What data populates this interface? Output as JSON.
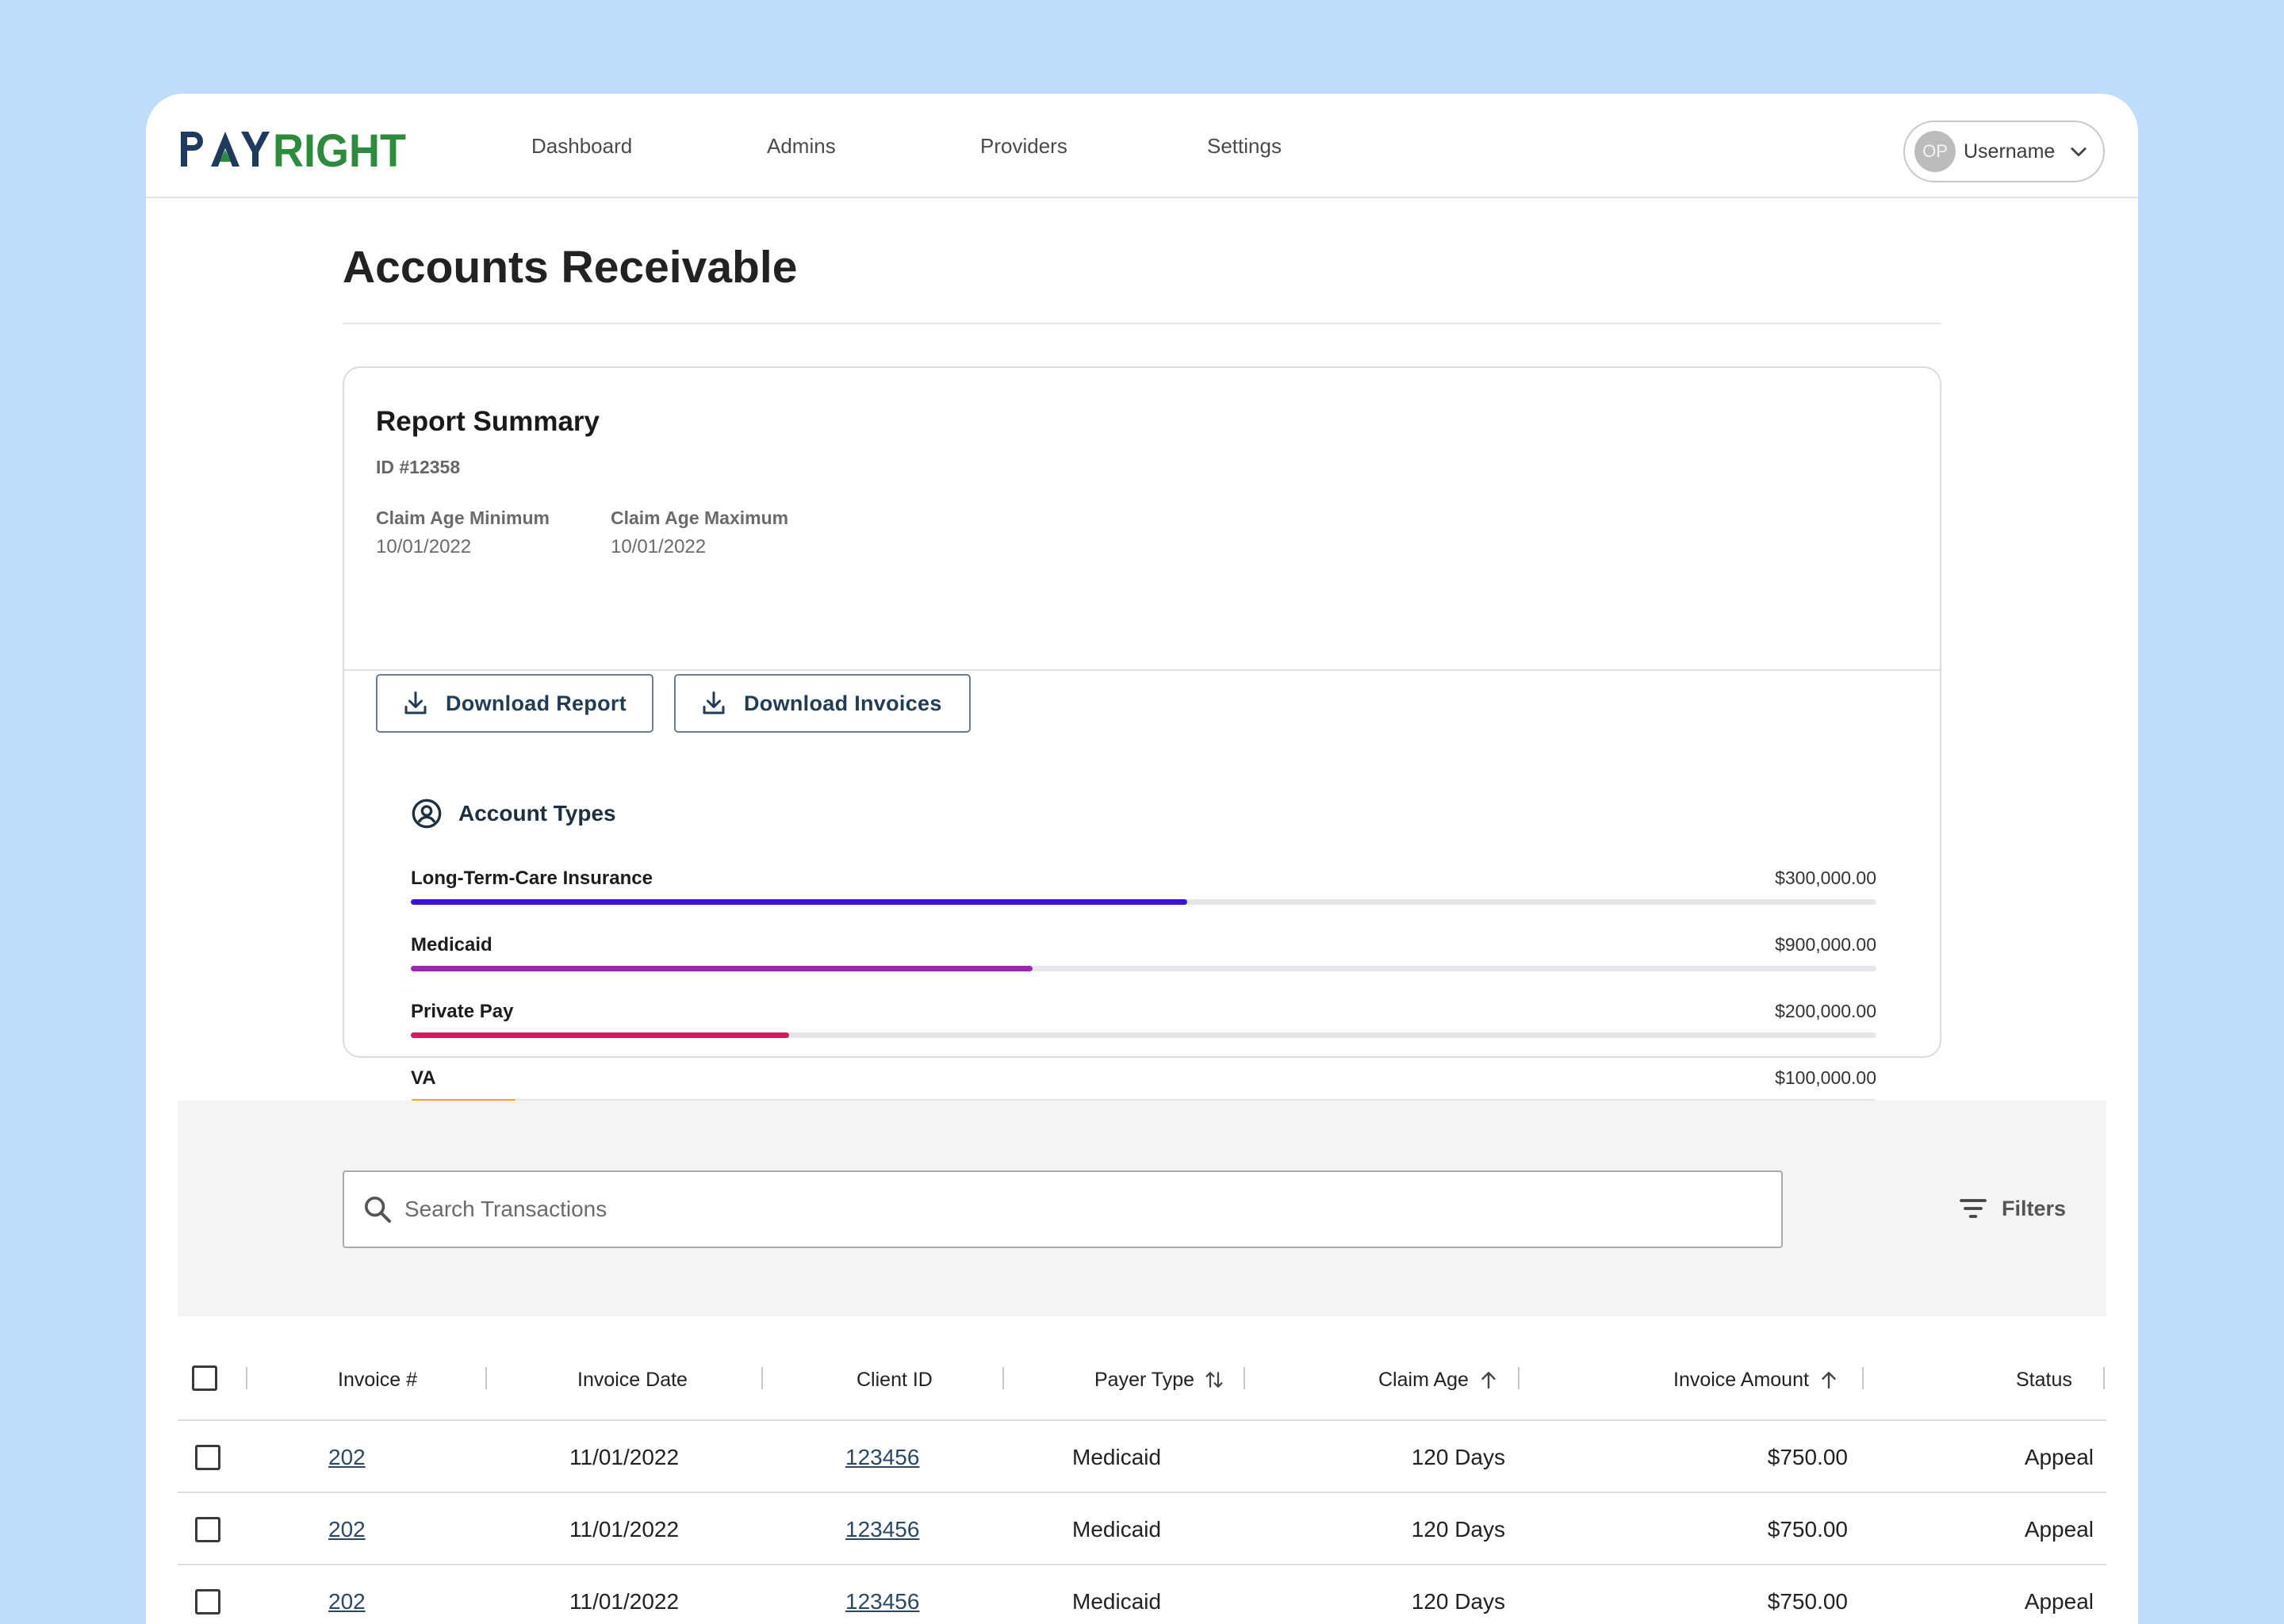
{
  "brand": {
    "logo_text": "PAYRIGHT",
    "colors": {
      "navy": "#1f3a5c",
      "green": "#2e8b3d",
      "accent_blue": "#bfdcfd"
    }
  },
  "nav": {
    "items": [
      "Dashboard",
      "Admins",
      "Providers",
      "Settings"
    ]
  },
  "user": {
    "initials": "OP",
    "name": "Username",
    "chevron_icon": "chevron-down-icon"
  },
  "page": {
    "title": "Accounts Receivable"
  },
  "report_summary": {
    "title": "Report Summary",
    "id": "ID #12358",
    "claim_age_min_label": "Claim Age Minimum",
    "claim_age_min_value": "10/01/2022",
    "claim_age_max_label": "Claim Age Maximum",
    "claim_age_max_value": "10/01/2022",
    "download_report_label": "Download Report",
    "download_invoices_label": "Download Invoices",
    "download_icon": "download-icon"
  },
  "account_types": {
    "title": "Account Types",
    "icon": "user-circle-icon",
    "items": [
      {
        "name": "Long-Term-Care Insurance",
        "amount": "$300,000.00",
        "fill": 0.53,
        "color": "#3d12d6"
      },
      {
        "name": "Medicaid",
        "amount": "$900,000.00",
        "fill": 0.424,
        "color": "#9c27b0"
      },
      {
        "name": "Private Pay",
        "amount": "$200,000.00",
        "fill": 0.258,
        "color": "#d0195e"
      },
      {
        "name": "VA",
        "amount": "$100,000.00",
        "fill": 0.072,
        "color": "#f5a01a"
      }
    ]
  },
  "search": {
    "placeholder": "Search Transactions",
    "icon": "search-icon"
  },
  "filters": {
    "label": "Filters",
    "icon": "filter-icon"
  },
  "table": {
    "columns": {
      "invoice": "Invoice #",
      "date": "Invoice Date",
      "client": "Client ID",
      "payer": "Payer Type",
      "age": "Claim Age",
      "amount": "Invoice Amount",
      "status": "Status"
    },
    "rows": [
      {
        "invoice": "202",
        "date": "11/01/2022",
        "client": "123456",
        "payer": "Medicaid",
        "age": "120 Days",
        "amount": "$750.00",
        "status": "Appeal"
      },
      {
        "invoice": "202",
        "date": "11/01/2022",
        "client": "123456",
        "payer": "Medicaid",
        "age": "120 Days",
        "amount": "$750.00",
        "status": "Appeal"
      },
      {
        "invoice": "202",
        "date": "11/01/2022",
        "client": "123456",
        "payer": "Medicaid",
        "age": "120 Days",
        "amount": "$750.00",
        "status": "Appeal"
      }
    ]
  }
}
